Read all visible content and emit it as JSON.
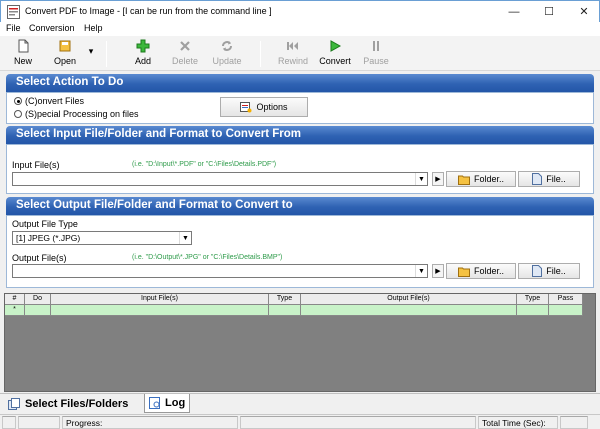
{
  "window": {
    "title": "Convert PDF to Image - [I can be run from the command line ]",
    "minimize": "—",
    "maximize": "☐",
    "close": "✕"
  },
  "menu": {
    "file": "File",
    "conversion": "Conversion",
    "help": "Help"
  },
  "toolbar": {
    "new": "New",
    "open": "Open",
    "open_dropdown": "▾",
    "add": "Add",
    "delete": "Delete",
    "update": "Update",
    "rewind": "Rewind",
    "convert": "Convert",
    "pause": "Pause"
  },
  "action_section": {
    "title": "Select Action To Do",
    "convert_files": "(C)onvert Files",
    "special_processing": "(S)pecial Processing on files",
    "options_button": "Options"
  },
  "input_section": {
    "title": "Select Input File/Folder and Format to Convert From",
    "input_label": "Input File(s)",
    "input_hint": "(i.e. \"D:\\Input\\*.PDF\"  or  \"C:\\Files\\Details.PDF\")",
    "input_value": "",
    "folder_button": "Folder..",
    "file_button": "File.."
  },
  "output_section": {
    "title": "Select Output File/Folder and Format to Convert to",
    "type_label": "Output File Type",
    "type_value": "[1] JPEG (*.JPG)",
    "output_label": "Output File(s)",
    "output_hint": "(i.e. \"D:\\Output\\*.JPG\"  or  \"C:\\Files\\Details.BMP\")",
    "output_value": "",
    "folder_button": "Folder..",
    "file_button": "File.."
  },
  "grid": {
    "columns": [
      "#",
      "Do",
      "Input File(s)",
      "Type",
      "Output File(s)",
      "Type",
      "Pass"
    ],
    "new_row_marker": "*"
  },
  "tabs": {
    "select_files": "Select Files/Folders",
    "log": "Log"
  },
  "status": {
    "progress_label": "Progress:",
    "total_time_label": "Total Time (Sec):"
  },
  "colors": {
    "section_header": "#2f62b3",
    "hint": "#2e9b4a",
    "new_row": "#c8f2c8",
    "grid_bg": "#808080"
  }
}
